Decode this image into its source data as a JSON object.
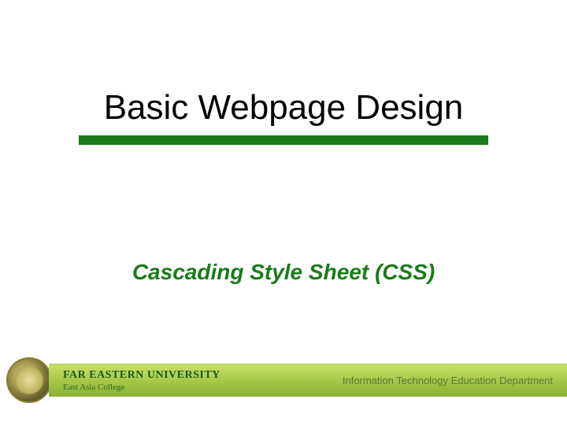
{
  "slide": {
    "title": "Basic Webpage Design",
    "subtitle": "Cascading Style Sheet (CSS)"
  },
  "footer": {
    "university": "FAR EASTERN UNIVERSITY",
    "college": "East Asia College",
    "department": "Information Technology Education Department"
  },
  "colors": {
    "accent": "#1a7a1a",
    "footer_gradient_top": "#c8e068",
    "footer_gradient_bottom": "#8ab030"
  }
}
